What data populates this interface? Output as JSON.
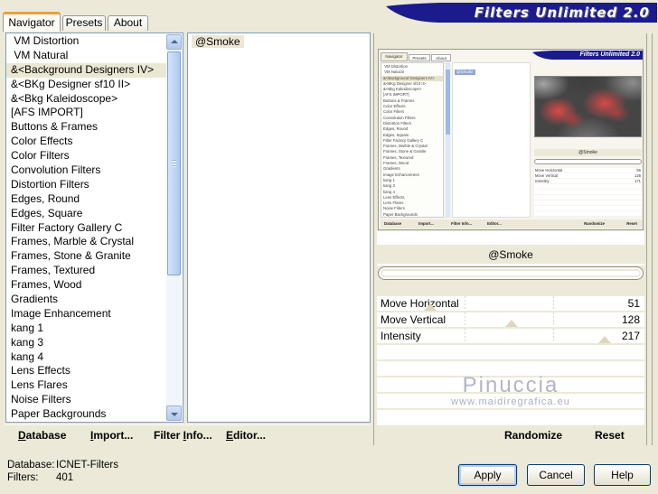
{
  "window": {
    "banner_title": "Filters Unlimited 2.0"
  },
  "tabs": [
    {
      "label": "Navigator",
      "active": true
    },
    {
      "label": "Presets",
      "active": false
    },
    {
      "label": "About",
      "active": false
    }
  ],
  "category_list": {
    "items": [
      " VM Distortion",
      " VM Natural",
      "&<Background Designers IV>",
      "&<BKg Designer sf10 II>",
      "&<Bkg Kaleidoscope>",
      "[AFS IMPORT]",
      "Buttons & Frames",
      "Color Effects",
      "Color Filters",
      "Convolution Filters",
      "Distortion Filters",
      "Edges, Round",
      "Edges, Square",
      "Filter Factory Gallery C",
      "Frames, Marble & Crystal",
      "Frames, Stone & Granite",
      "Frames, Textured",
      "Frames, Wood",
      "Gradients",
      "Image Enhancement",
      "kang 1",
      "kang 3",
      "kang 4",
      "Lens Effects",
      "Lens Flares",
      "Noise Filters",
      "Paper Backgrounds"
    ],
    "selected": "&<Background Designers IV>"
  },
  "filter_list": {
    "items": [
      "@Smoke"
    ],
    "selected": "@Smoke"
  },
  "preview": {
    "filter_name_bar": "@Smoke",
    "sliders": [
      {
        "label": "Move Horizontal",
        "value": 51,
        "max": 255
      },
      {
        "label": "Move Vertical",
        "value": 128,
        "max": 255
      },
      {
        "label": "Intensity",
        "value": 217,
        "max": 255
      }
    ],
    "watermark": {
      "line1": "Pinuccia",
      "line2": "www.maidiregrafica.eu"
    },
    "buttons": {
      "randomize": "Randomize",
      "reset": "Reset"
    },
    "thumbnail": {
      "banner_title": "Filters Unlimited 2.0",
      "tabs": [
        "Navigator",
        "Presets",
        "About"
      ],
      "selected_filter": "@Smoke",
      "filter_name_bar": "@Smoke",
      "sliders": [
        {
          "label": "Move Horizontal",
          "value": 56
        },
        {
          "label": "Move Vertical",
          "value": 128
        },
        {
          "label": "Intensity",
          "value": 171
        }
      ],
      "menu": [
        "Database",
        "Import...",
        "Filter Info...",
        "Editor..."
      ],
      "buttons": [
        "Randomize",
        "Reset"
      ]
    }
  },
  "menu_bar": {
    "items": [
      {
        "label": "Database",
        "underline": 0
      },
      {
        "label": "Import...",
        "underline": 0
      },
      {
        "label": "Filter Info...",
        "underline": 7
      },
      {
        "label": "Editor...",
        "underline": 0
      }
    ]
  },
  "status": {
    "database_label": "Database:",
    "database_value": "ICNET-Filters",
    "filters_label": "Filters:",
    "filters_value": "401"
  },
  "action_buttons": {
    "apply": "Apply",
    "cancel": "Cancel",
    "help": "Help"
  },
  "colors": {
    "banner_blue": "#1b1b8e",
    "dialog_beige": "#ece9d8",
    "selection_cream": "#ece7d3",
    "mini_selection_blue": "#8fa3d9",
    "tab_accent_orange": "#ef9e3a"
  }
}
